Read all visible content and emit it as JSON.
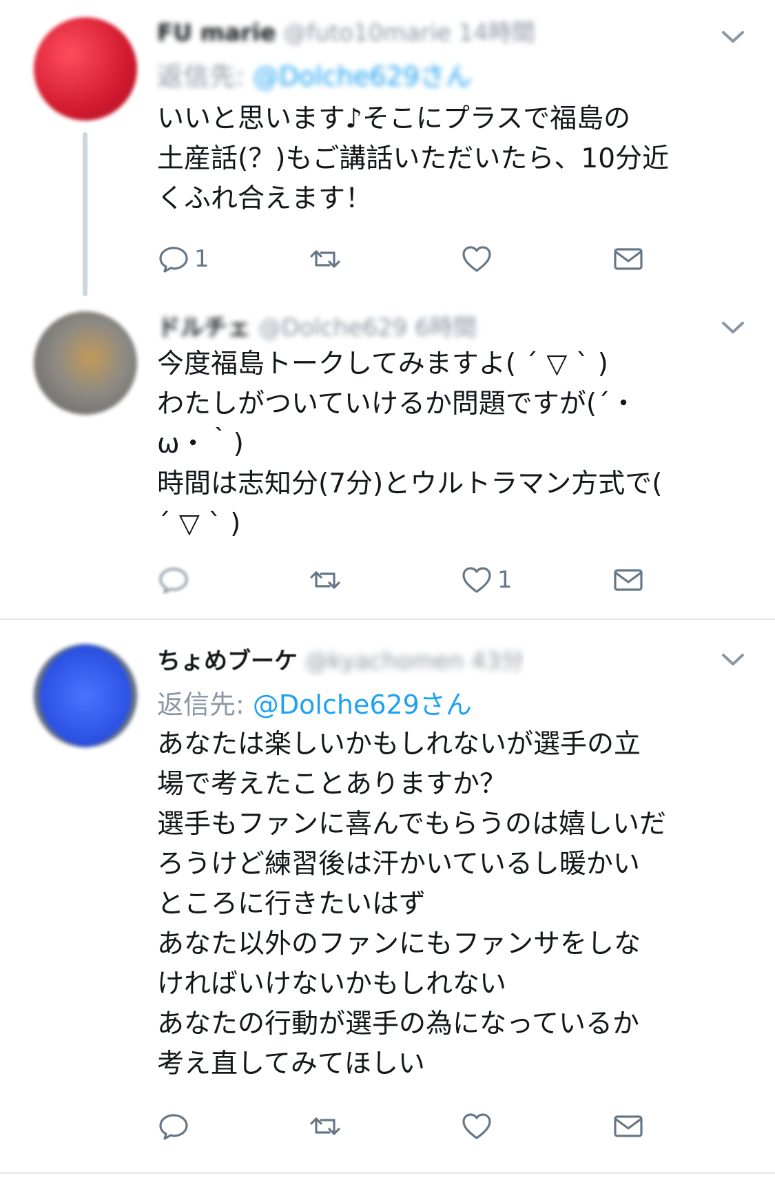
{
  "tweets": [
    {
      "name": "FU marie",
      "handle": "@futo10marie",
      "time": "14時間",
      "reply_label": "返信先:",
      "reply_handle": "@Dolche629さん",
      "text": "いいと思います♪そこにプラスで福島の\n土産話(？)もご講話いただいたら、10分近\nくふれ合えます！",
      "reply_count": "1",
      "retweet_count": "",
      "like_count": "",
      "avatar_color": "#e0243a"
    },
    {
      "name": "ドルチェ",
      "handle": "@Dolche629",
      "time": "6時間",
      "text": "今度福島トークしてみますよ( ´ ▽ ` )\nわたしがついていけるか問題ですが(´・\nω・｀)\n時間は志知分(7分)とウルトラマン方式で(\n´ ▽ ` )",
      "reply_count": "",
      "retweet_count": "",
      "like_count": "1",
      "avatar_color": "#8a8a86"
    },
    {
      "name": "ちょめブーケ",
      "handle": "@kyachomen",
      "time": "43分",
      "reply_label": "返信先:",
      "reply_handle": "@Dolche629さん",
      "text": "あなたは楽しいかもしれないが選手の立\n場で考えたことありますか？\n選手もファンに喜んでもらうのは嬉しいだ\nろうけど練習後は汗かいているし暖かい\nところに行きたいはず\nあなた以外のファンにもファンサをしな\nければいけないかもしれない\nあなたの行動が選手の為になっているか\n考え直してみてほしい",
      "reply_count": "",
      "retweet_count": "",
      "like_count": "",
      "avatar_color": "#3a62e8"
    }
  ],
  "colors": {
    "accent": "#1da1f2",
    "icon": "#657786",
    "thread_line": "#ccd6dd"
  },
  "icons": [
    "reply-icon",
    "retweet-icon",
    "like-icon",
    "dm-icon",
    "chevron-down-icon"
  ]
}
